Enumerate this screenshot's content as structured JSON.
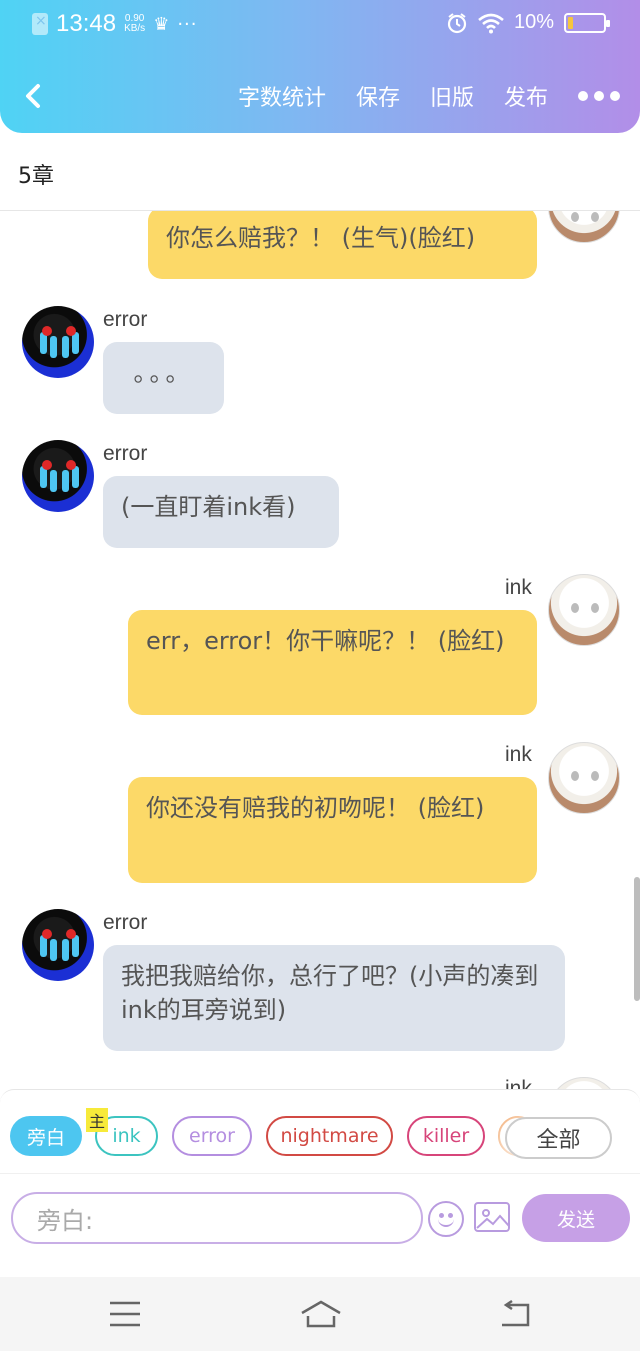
{
  "status_bar": {
    "time": "13:48",
    "speed_value": "0.90",
    "speed_unit": "KB/s",
    "dots": "···",
    "battery": "10%"
  },
  "nav": {
    "word_count": "字数统计",
    "save": "保存",
    "old_version": "旧版",
    "publish": "发布"
  },
  "chapter": {
    "title": "5章"
  },
  "messages": [
    {
      "speaker": "",
      "side": "right",
      "text": "你怎么赔我？！ (生气)(脸红)"
    },
    {
      "speaker": "error",
      "side": "left",
      "text": "。。。"
    },
    {
      "speaker": "error",
      "side": "left",
      "text": "(一直盯着ink看)"
    },
    {
      "speaker": "ink",
      "side": "right",
      "text": "err，error！你干嘛呢？！ (脸红)"
    },
    {
      "speaker": "ink",
      "side": "right",
      "text": "你还没有赔我的初吻呢！ (脸红)"
    },
    {
      "speaker": "error",
      "side": "left",
      "text": "我把我赔给你，总行了吧？(小声的凑到ink的耳旁说到)"
    },
    {
      "speaker": "ink",
      "side": "right",
      "text": ""
    }
  ],
  "composer": {
    "tags": [
      "旁白",
      "ink",
      "error",
      "nightmare",
      "killer"
    ],
    "main_badge": "主",
    "all_label": "全部",
    "input_placeholder": "旁白:",
    "send_label": "发送"
  },
  "colors": {
    "header_gradient_start": "#4fd3f4",
    "header_gradient_end": "#b28ee8",
    "bubble_right": "#fcd968",
    "bubble_left": "#dde3ec",
    "tag_active": "#4dc6f0",
    "tag_ink": "#3cc4c0",
    "tag_error": "#b48ee0",
    "tag_nightmare": "#d24a44",
    "tag_killer": "#d7457a",
    "send": "#c6a0e6"
  }
}
